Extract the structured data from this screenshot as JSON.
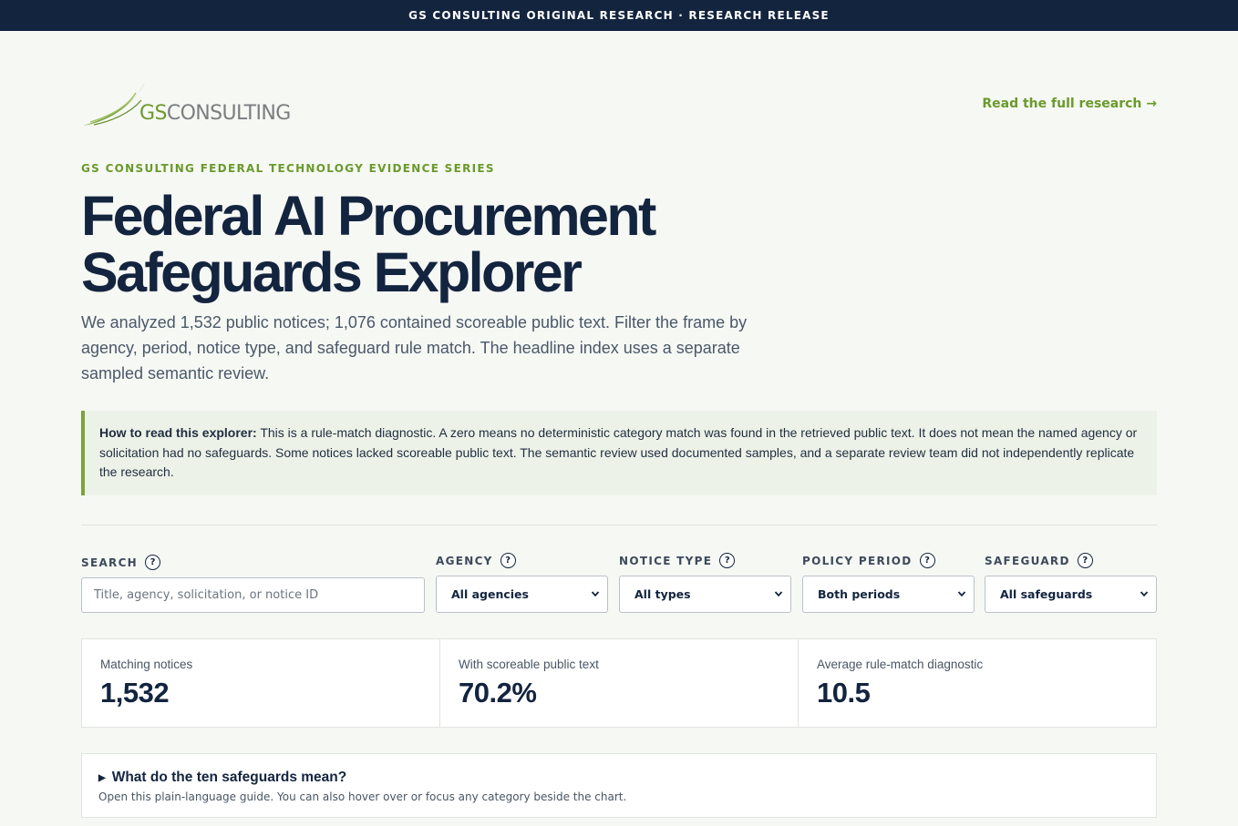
{
  "topbar": {
    "text": "GS CONSULTING ORIGINAL RESEARCH · RESEARCH RELEASE"
  },
  "header": {
    "logo": {
      "prefix": "GS",
      "suffix": "CONSULTING",
      "icon": "swoosh-logo-icon"
    },
    "read_link": "Read the full research →"
  },
  "hero": {
    "eyebrow": "GS CONSULTING FEDERAL TECHNOLOGY EVIDENCE SERIES",
    "title_line1": "Federal AI Procurement",
    "title_line2": "Safeguards Explorer",
    "lede": "We analyzed 1,532 public notices; 1,076 contained scoreable public text. Filter the frame by agency, period, notice type, and safeguard rule match. The headline index uses a separate sampled semantic review."
  },
  "callout": {
    "lead": "How to read this explorer:",
    "body": " This is a rule-match diagnostic. A zero means no deterministic category match was found in the retrieved public text. It does not mean the named agency or solicitation had no safeguards. Some notices lacked scoreable public text. The semantic review used documented samples, and a separate review team did not independently replicate the research."
  },
  "filters": {
    "help_glyph": "?",
    "search": {
      "label": "SEARCH",
      "placeholder": "Title, agency, solicitation, or notice ID"
    },
    "agency": {
      "label": "AGENCY",
      "value": "All agencies"
    },
    "notice_type": {
      "label": "NOTICE TYPE",
      "value": "All types"
    },
    "policy_period": {
      "label": "POLICY PERIOD",
      "value": "Both periods"
    },
    "safeguard": {
      "label": "SAFEGUARD",
      "value": "All safeguards"
    }
  },
  "stats": [
    {
      "label": "Matching notices",
      "value": "1,532"
    },
    {
      "label": "With scoreable public text",
      "value": "70.2%"
    },
    {
      "label": "Average rule-match diagnostic",
      "value": "10.5"
    }
  ],
  "guide": {
    "title": "What do the ten safeguards mean?",
    "subtitle": "Open this plain-language guide. You can also hover over or focus any category beside the chart.",
    "toggle_glyph": "▶"
  },
  "colors": {
    "navy": "#13243f",
    "green": "#6a9a2a",
    "background": "#f6f8f4",
    "callout_bg": "#edf2e8"
  }
}
